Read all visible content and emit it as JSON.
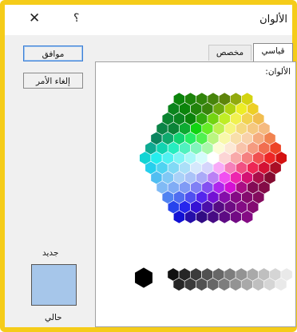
{
  "window": {
    "title": "الألوان",
    "help_glyph": "؟",
    "close_glyph": "✕"
  },
  "buttons": {
    "ok_label": "موافق",
    "cancel_label": "إلغاء الأمر"
  },
  "tabs": [
    {
      "label": "قياسي",
      "selected": true
    },
    {
      "label": "مخصص",
      "selected": false
    }
  ],
  "panel": {
    "colors_label": "الألوان:"
  },
  "preview": {
    "new_label": "جديد",
    "current_label": "حالي",
    "color": "#a6c6ea"
  }
}
